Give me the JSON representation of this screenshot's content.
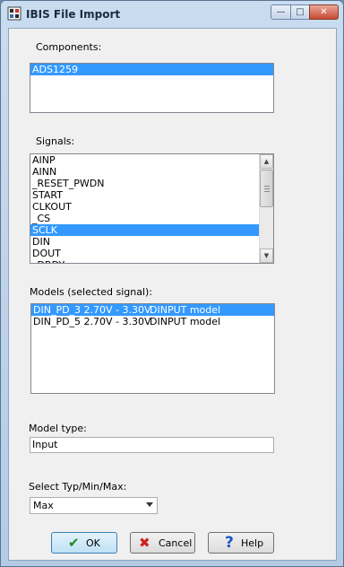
{
  "window": {
    "title": "IBIS File Import",
    "minimize_glyph": "—",
    "maximize_glyph": "□",
    "close_glyph": "✕",
    "icon": "ibis-app-icon"
  },
  "components": {
    "label": "Components:",
    "items": [
      "ADS1259"
    ],
    "selected_index": 0
  },
  "signals": {
    "label": "Signals:",
    "items": [
      "AINP",
      "AINN",
      "_RESET_PWDN",
      "START",
      "CLKOUT",
      "_CS",
      "SCLK",
      "DIN",
      "DOUT",
      "_DRDY"
    ],
    "selected_index": 6
  },
  "models": {
    "label": "Models (selected signal):",
    "items": [
      {
        "name": "DIN_PD_3 2.70V - 3.30V",
        "type": "DINPUT model"
      },
      {
        "name": "DIN_PD_5 2.70V - 3.30V",
        "type": "DINPUT model"
      }
    ],
    "selected_index": 0
  },
  "model_type": {
    "label": "Model type:",
    "value": "Input"
  },
  "typminmax": {
    "label": "Select Typ/Min/Max:",
    "value": "Max"
  },
  "buttons": {
    "ok": {
      "label": "OK",
      "icon": "check-icon",
      "glyph": "✔"
    },
    "cancel": {
      "label": "Cancel",
      "icon": "x-icon",
      "glyph": "✖"
    },
    "help": {
      "label": "Help",
      "icon": "question-icon",
      "glyph": "?"
    }
  },
  "colors": {
    "selection": "#3399ff",
    "ok_icon": "#1e8a1e",
    "cancel_icon": "#cc2222",
    "help_icon": "#1a57c7"
  }
}
